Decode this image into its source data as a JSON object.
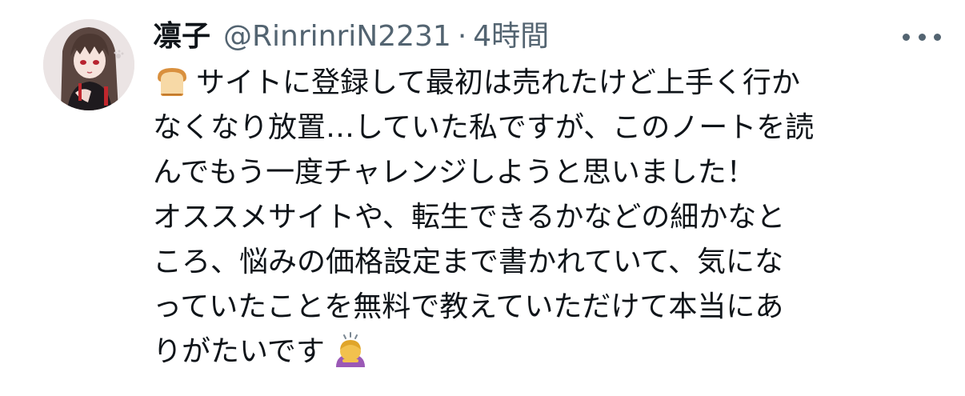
{
  "tweet": {
    "author": {
      "display_name": "凛子",
      "handle": "@RinrinriN2231"
    },
    "separator": "·",
    "time": "4時間",
    "more_icon": "ellipsis-icon",
    "body": {
      "leading_emoji": "bread-emoji",
      "lines": [
        "サイトに登録して最初は売れたけど上手く行か",
        "なくなり放置…していた私ですが、このノートを読",
        "んでもう一度チャレンジしようと思いました！",
        "オススメサイトや、転生できるかなどの細かなと",
        "ころ、悩みの価格設定まで書かれていて、気にな",
        "っていたことを無料で教えていただけて本当にあ",
        "りがたいです"
      ],
      "trailing_emoji": "person-bowing-emoji"
    }
  },
  "colors": {
    "text_primary": "#0f1419",
    "text_secondary": "#536471",
    "background": "#ffffff"
  }
}
